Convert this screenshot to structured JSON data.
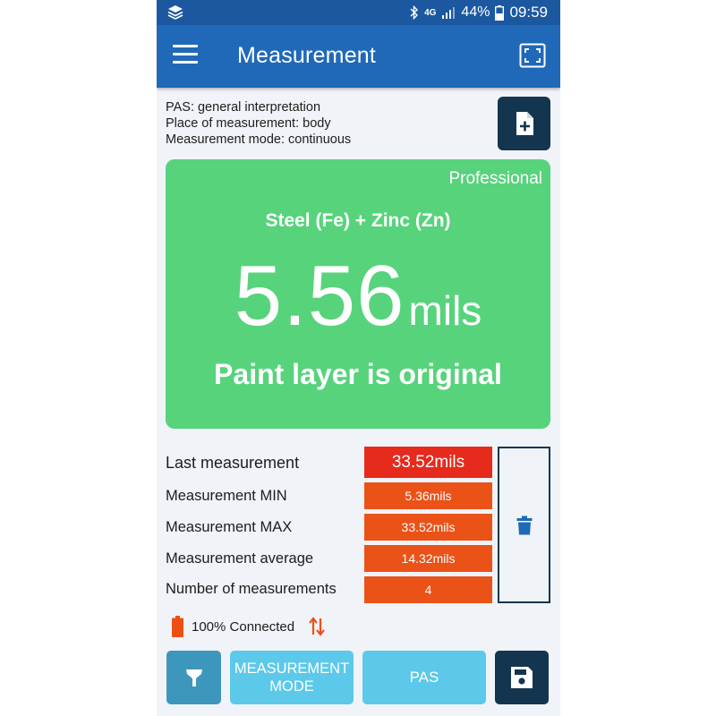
{
  "status_bar": {
    "network": "4G",
    "battery": "44%",
    "time": "09:59",
    "icons": [
      "layers-icon",
      "bluetooth-icon",
      "signal-icon",
      "battery-icon"
    ]
  },
  "app_bar": {
    "title": "Measurement",
    "icons": [
      "menu-icon",
      "fullscreen-icon"
    ]
  },
  "info": {
    "pas": "PAS: general interpretation",
    "place": "Place of measurement: body",
    "mode": "Measurement mode: continuous"
  },
  "result": {
    "tier": "Professional",
    "material": "Steel (Fe) + Zinc (Zn)",
    "value": "5.56",
    "unit": "mils",
    "verdict": "Paint layer is original"
  },
  "stats": {
    "last_label": "Last measurement",
    "last_value": "33.52mils",
    "min_label": "Measurement MIN",
    "min_value": "5.36mils",
    "max_label": "Measurement MAX",
    "max_value": "33.52mils",
    "avg_label": "Measurement average",
    "avg_value": "14.32mils",
    "count_label": "Number of measurements",
    "count_value": "4"
  },
  "connection": {
    "text": "100% Connected"
  },
  "bottom_bar": {
    "mode_label": "MEASUREMENT MODE",
    "pas_label": "PAS"
  },
  "colors": {
    "status_bar": "#1c58a0",
    "app_bar": "#2069b8",
    "result_ok": "#57d37c",
    "last_measurement": "#e62a1c",
    "stat_value": "#eb5218",
    "dark_button": "#14354f",
    "light_button": "#5cc9ea",
    "flashlight_button": "#3d97bd"
  }
}
